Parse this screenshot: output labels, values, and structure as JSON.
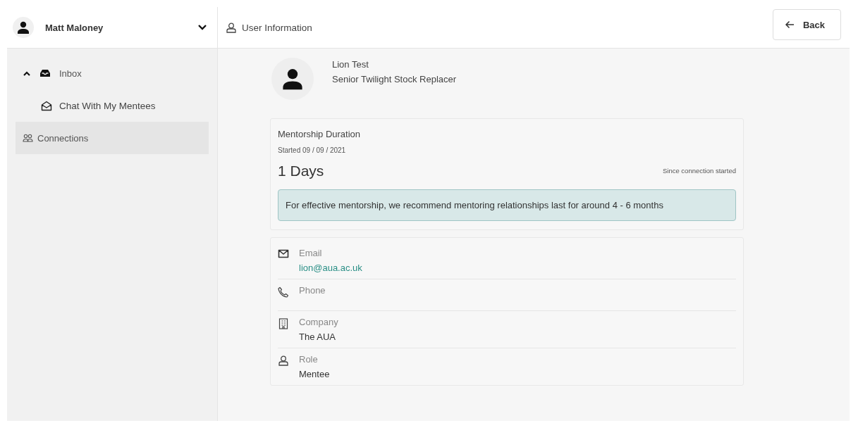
{
  "user": {
    "name": "Matt Maloney"
  },
  "nav": [
    {
      "label": "Inbox",
      "kind": "group",
      "expanded": true,
      "selected": false,
      "children": [
        {
          "label": "Chat With My Mentees",
          "kind": "chat",
          "selected": false
        }
      ]
    },
    {
      "label": "Connections",
      "kind": "connections",
      "selected": true
    }
  ],
  "header": {
    "title": "User Information"
  },
  "back_button": {
    "label": "Back"
  },
  "profile": {
    "name": "Lion Test",
    "role": "Senior Twilight Stock Replacer"
  },
  "duration": {
    "title": "Mentorship Duration",
    "started": "Started 09 / 09 / 2021",
    "value": "1 Days",
    "caption": "Since connection started",
    "note": "For effective mentorship, we recommend mentoring relationships last for around 4 - 6 months"
  },
  "details": [
    {
      "kind": "email",
      "label": "Email",
      "value": "lion@aua.ac.uk"
    },
    {
      "kind": "phone",
      "label": "Phone"
    },
    {
      "kind": "company",
      "label": "Company",
      "value": "The AUA"
    },
    {
      "kind": "role",
      "label": "Role",
      "value": "Mentee"
    }
  ]
}
